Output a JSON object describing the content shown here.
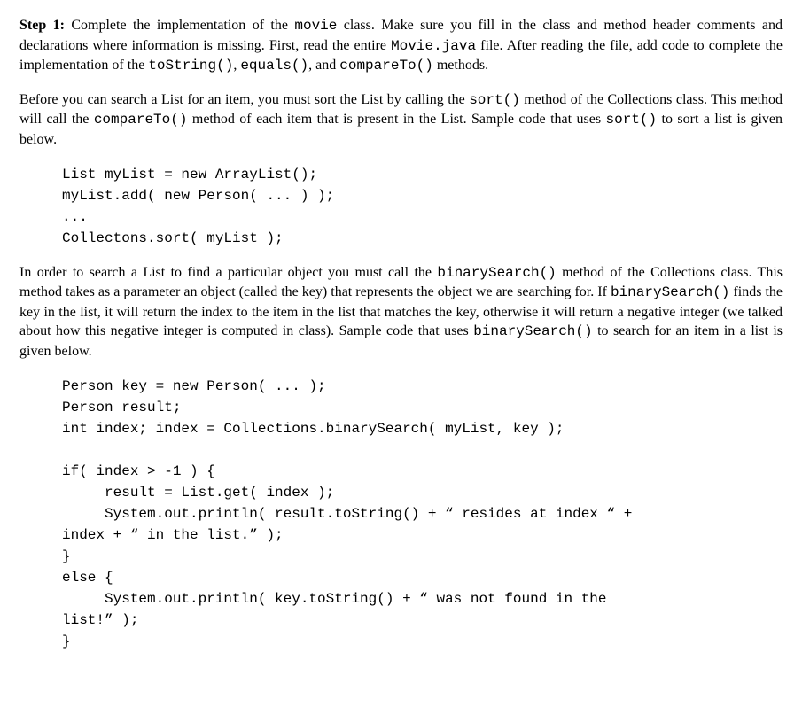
{
  "para1": {
    "step_label": "Step 1:",
    "t1": " Complete the implementation of the ",
    "c1": "movie",
    "t2": " class. Make sure you fill in the class and method header comments and declarations where information is missing. First, read the entire ",
    "c2": "Movie.java",
    "t3": " file. After reading the file, add code to complete the implementation of the ",
    "c3": "toString()",
    "t4": ", ",
    "c4": "equals()",
    "t5": ", and ",
    "c5": "compareTo()",
    "t6": " methods."
  },
  "para2": {
    "t1": "Before you can search a List for an item, you must sort the List by calling the ",
    "c1": "sort()",
    "t2": " method of the Collections class. This method will call the ",
    "c2": "compareTo()",
    "t3": " method of each item that is present in the List. Sample code that uses ",
    "c3": "sort()",
    "t4": " to sort a list is given below."
  },
  "codeblock1": "List myList = new ArrayList();\nmyList.add( new Person( ... ) );\n...\nCollectons.sort( myList );",
  "para3": {
    "t1": "In order to search a List to find a particular object you must call the ",
    "c1": "binarySearch()",
    "t2": " method of the Collections class. This method takes as a parameter an object (called the key) that represents the object we are searching for. If ",
    "c2": "binarySearch()",
    "t3": " finds the key in the list, it will return the index to the item in the list that matches the key, otherwise it will return a negative integer (we talked about how this negative integer is computed in class). Sample code that uses ",
    "c3": "binarySearch()",
    "t4": " to search for an item in a list is given below."
  },
  "codeblock2": "Person key = new Person( ... );\nPerson result;\nint index; index = Collections.binarySearch( myList, key );\n\nif( index > -1 ) {\n     result = List.get( index );\n     System.out.println( result.toString() + “ resides at index “ +\nindex + “ in the list.” );\n}\nelse {\n     System.out.println( key.toString() + “ was not found in the\nlist!” );\n}"
}
